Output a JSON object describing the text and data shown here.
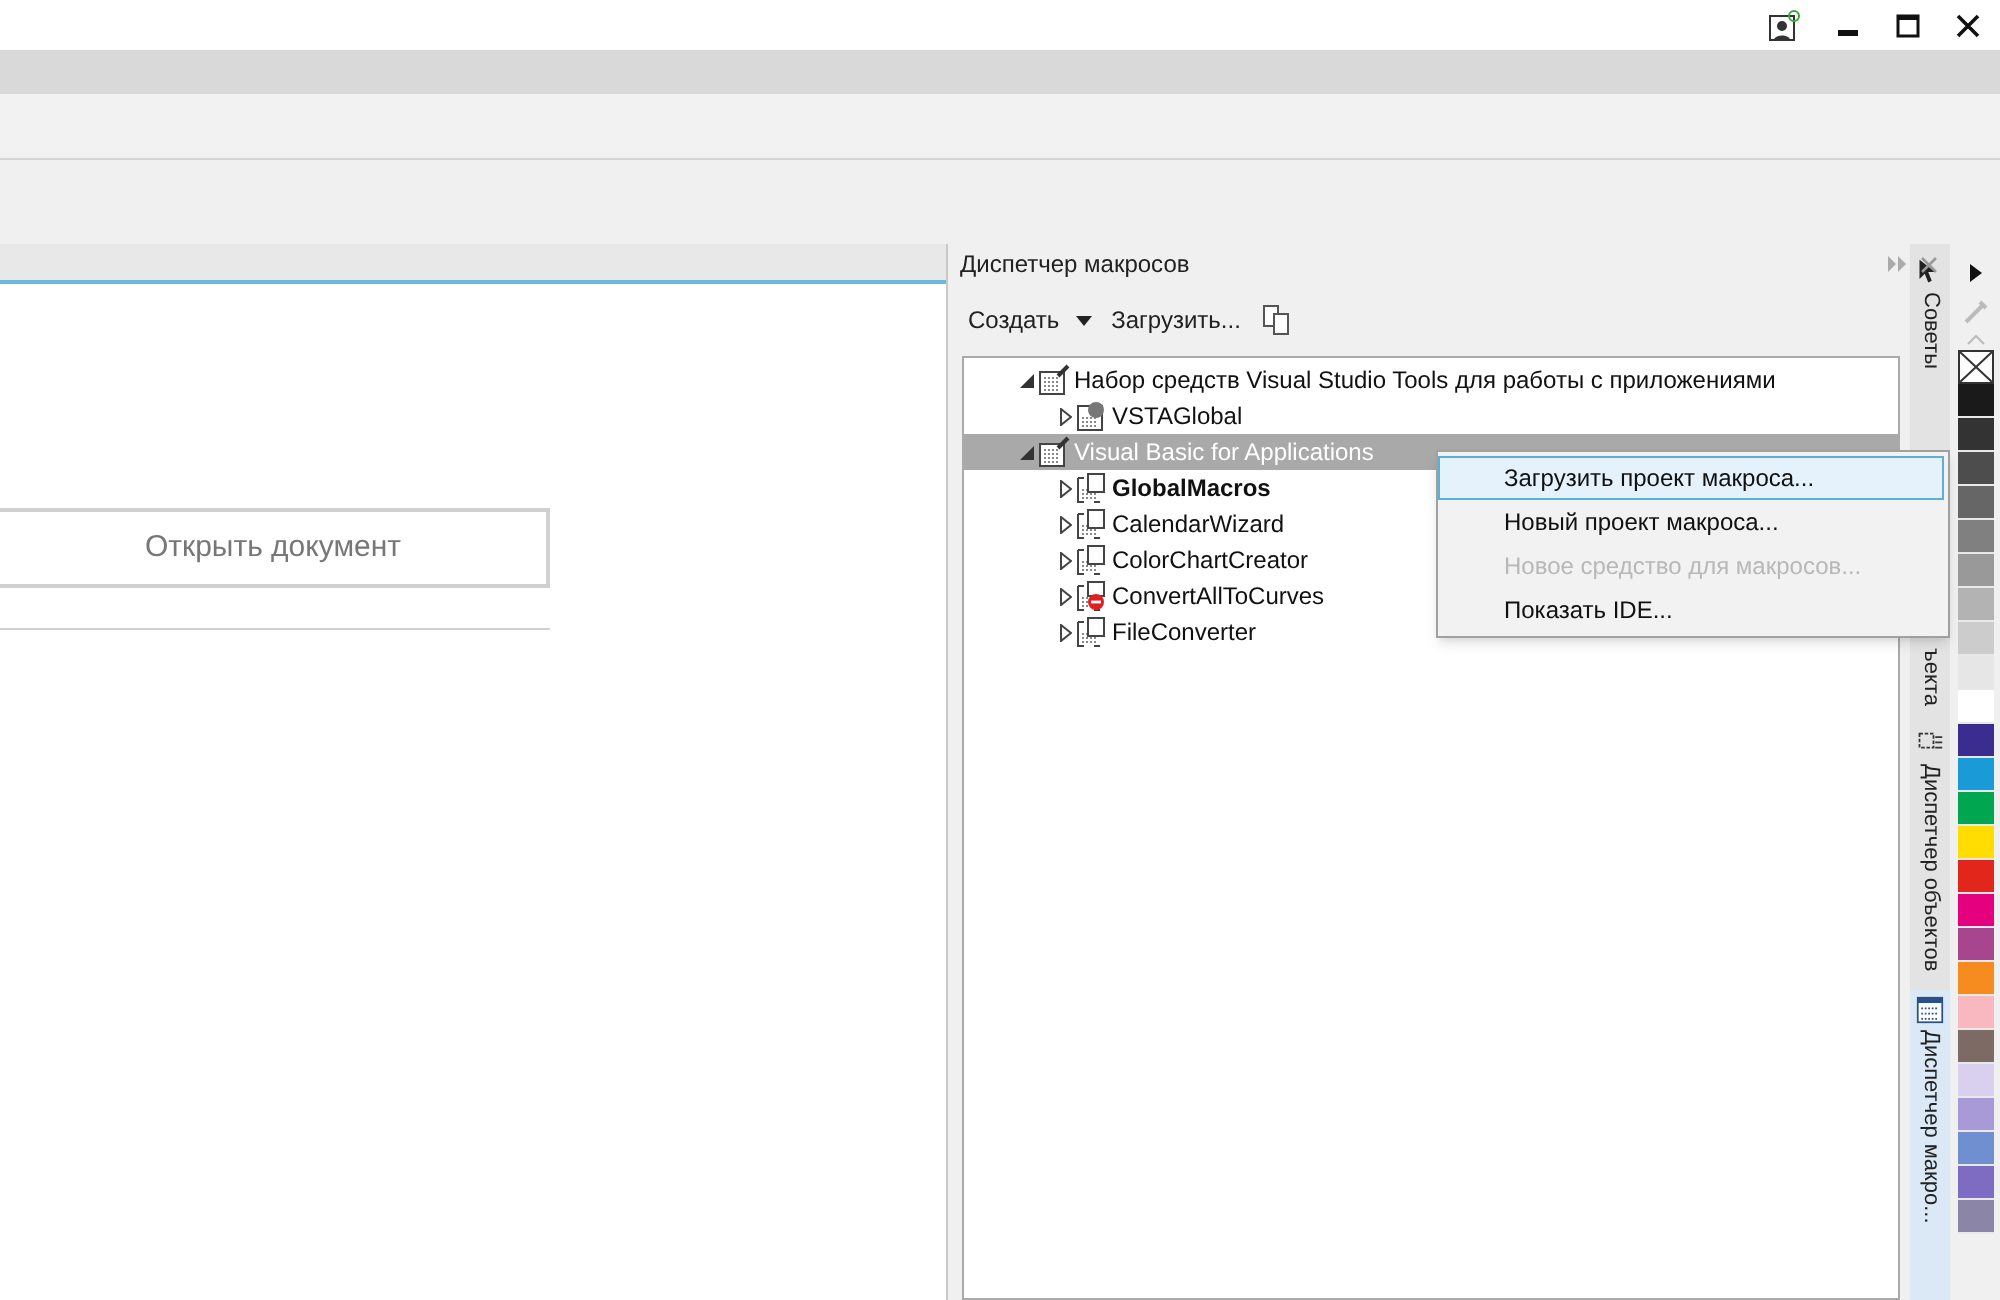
{
  "open_button": {
    "label": "Открыть документ"
  },
  "docker": {
    "title": "Диспетчер макросов",
    "create_label": "Создать",
    "load_label": "Загрузить..."
  },
  "tree": [
    {
      "label": "Набор средств Visual Studio Tools для работы с приложениями",
      "kind": "root",
      "expanded": true,
      "selected": false,
      "bold": false,
      "children": [
        {
          "label": "VSTAGlobal",
          "kind": "vsta",
          "expanded": false,
          "selected": false,
          "bold": false
        }
      ]
    },
    {
      "label": "Visual Basic for Applications",
      "kind": "root",
      "expanded": true,
      "selected": true,
      "bold": false,
      "children": [
        {
          "label": "GlobalMacros",
          "kind": "module",
          "expanded": false,
          "selected": false,
          "bold": true
        },
        {
          "label": "CalendarWizard",
          "kind": "module",
          "expanded": false,
          "selected": false,
          "bold": false
        },
        {
          "label": "ColorChartCreator",
          "kind": "module",
          "expanded": false,
          "selected": false,
          "bold": false
        },
        {
          "label": "ConvertAllToCurves",
          "kind": "blocked",
          "expanded": false,
          "selected": false,
          "bold": false
        },
        {
          "label": "FileConverter",
          "kind": "module",
          "expanded": false,
          "selected": false,
          "bold": false
        }
      ]
    }
  ],
  "context_menu": [
    {
      "label": "Загрузить проект макроса...",
      "selected": true,
      "disabled": false
    },
    {
      "label": "Новый проект макроса...",
      "selected": false,
      "disabled": false
    },
    {
      "label": "Новое средство для макросов...",
      "selected": false,
      "disabled": true
    },
    {
      "label": "Показать IDE...",
      "selected": false,
      "disabled": false
    }
  ],
  "side_tabs": [
    {
      "label": "Советы",
      "kind": "hints",
      "selected": false
    },
    {
      "label": "ъекта",
      "kind": "plain",
      "selected": false
    },
    {
      "label": "Диспетчер объектов",
      "kind": "objects",
      "selected": false
    },
    {
      "label": "Диспетчер макро...",
      "kind": "macros",
      "selected": true
    }
  ],
  "palette": [
    {
      "kind": "none"
    },
    {
      "kind": "swatch",
      "color": "#1a1a1a"
    },
    {
      "kind": "swatch",
      "color": "#333333"
    },
    {
      "kind": "swatch",
      "color": "#4d4d4d"
    },
    {
      "kind": "swatch",
      "color": "#666666"
    },
    {
      "kind": "swatch",
      "color": "#808080"
    },
    {
      "kind": "swatch",
      "color": "#999999"
    },
    {
      "kind": "swatch",
      "color": "#b3b3b3"
    },
    {
      "kind": "swatch",
      "color": "#cccccc"
    },
    {
      "kind": "swatch",
      "color": "#e6e6e6"
    },
    {
      "kind": "swatch",
      "color": "#ffffff"
    },
    {
      "kind": "swatch",
      "color": "#3b2d8f"
    },
    {
      "kind": "swatch",
      "color": "#1a9bd7"
    },
    {
      "kind": "swatch",
      "color": "#00a650"
    },
    {
      "kind": "swatch",
      "color": "#ffdd00"
    },
    {
      "kind": "swatch",
      "color": "#e2261c"
    },
    {
      "kind": "swatch",
      "color": "#e5007e"
    },
    {
      "kind": "swatch",
      "color": "#a8458f"
    },
    {
      "kind": "swatch",
      "color": "#f68b1f"
    },
    {
      "kind": "swatch",
      "color": "#f9b8c0"
    },
    {
      "kind": "swatch",
      "color": "#7d6a64"
    },
    {
      "kind": "swatch",
      "color": "#d8d0ee"
    },
    {
      "kind": "swatch",
      "color": "#a89ad6"
    },
    {
      "kind": "swatch",
      "color": "#6f8fd0"
    },
    {
      "kind": "swatch",
      "color": "#7e6bc2"
    },
    {
      "kind": "swatch",
      "color": "#8b86a8"
    }
  ]
}
